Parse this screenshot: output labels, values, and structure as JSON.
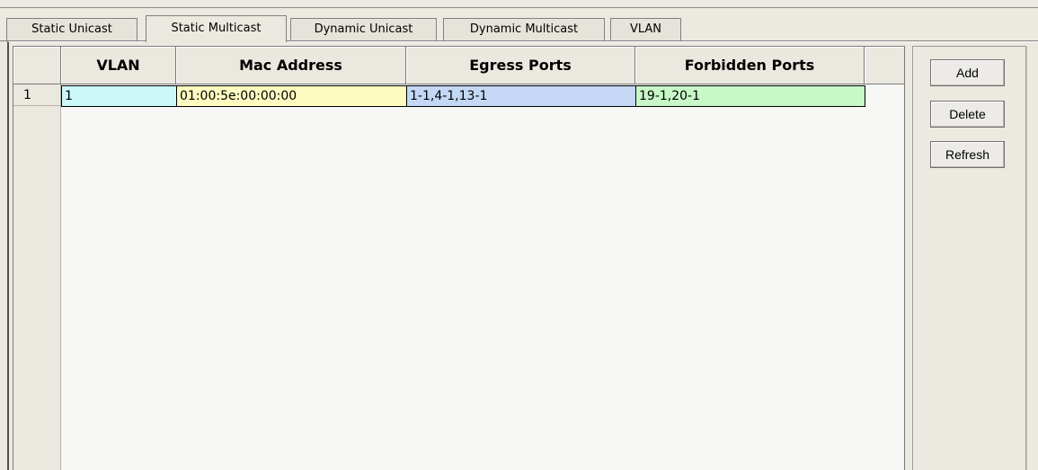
{
  "tabs": [
    {
      "label": "Static Unicast",
      "active": false
    },
    {
      "label": "Static Multicast",
      "active": true
    },
    {
      "label": "Dynamic Unicast",
      "active": false
    },
    {
      "label": "Dynamic Multicast",
      "active": false
    },
    {
      "label": "VLAN",
      "active": false
    }
  ],
  "table": {
    "columns": [
      "VLAN",
      "Mac Address",
      "Egress Ports",
      "Forbidden Ports"
    ],
    "rows": [
      {
        "index": "1",
        "vlan": "1",
        "mac": "01:00:5e:00:00:00",
        "egress": "1-1,4-1,13-1",
        "forbidden": "19-1,20-1"
      }
    ],
    "cell_colors": {
      "vlan": "#ccf8fa",
      "mac": "#fdfbc0",
      "egress": "#c4d8f6",
      "forbidden": "#c8f8c8"
    }
  },
  "buttons": {
    "add": "Add",
    "delete": "Delete",
    "refresh": "Refresh"
  }
}
